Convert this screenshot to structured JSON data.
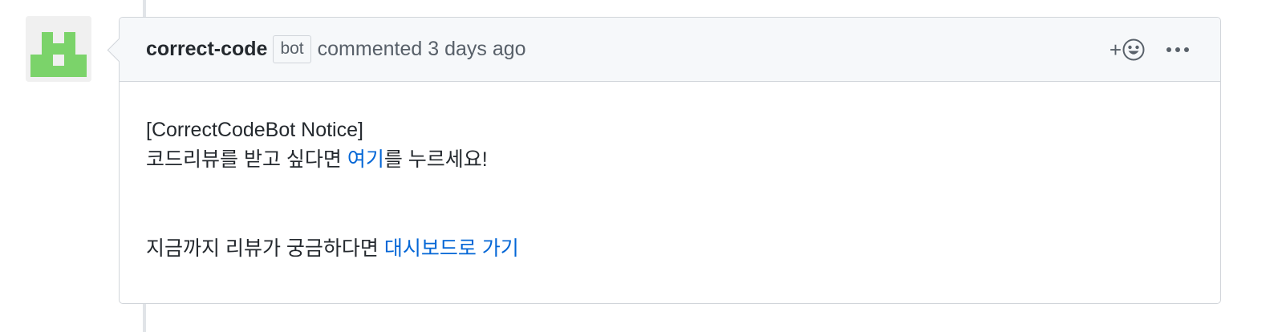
{
  "comment": {
    "author": "correct-code",
    "badge": "bot",
    "meta": "commented 3 days ago",
    "actions": {
      "reaction_icon": "smiley-icon",
      "reaction_plus": "+",
      "more_icon": "kebab-horizontal-icon"
    },
    "body": {
      "line1": "[CorrectCodeBot Notice]",
      "line2_prefix": "코드리뷰를 받고 싶다면 ",
      "line2_link": "여기",
      "line2_suffix": "를 누르세요!",
      "line3_prefix": "지금까지 리뷰가 궁금하다면 ",
      "line3_link": "대시보드로 가기"
    }
  },
  "colors": {
    "avatar_green": "#7bd36a",
    "link": "#0366d6",
    "header_bg": "#f6f8fa",
    "border": "#d1d5da"
  }
}
